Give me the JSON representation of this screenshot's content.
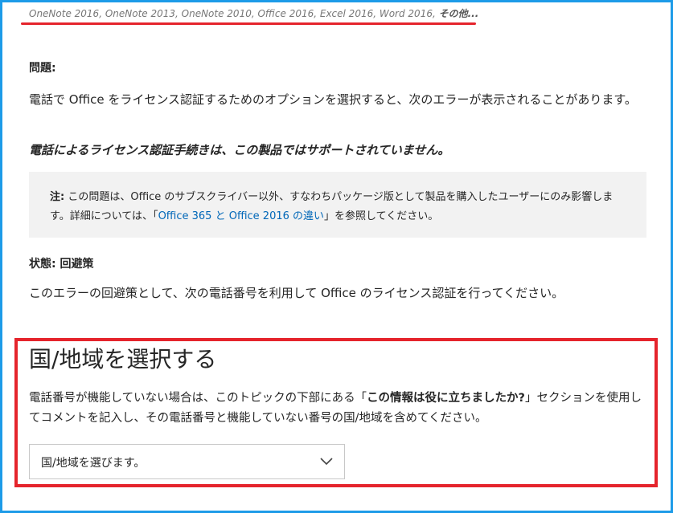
{
  "products": {
    "list": "OneNote 2016, OneNote 2013, OneNote 2010, Office 2016, Excel 2016, Word 2016, ",
    "more": "その他..."
  },
  "issue": {
    "label": "問題:",
    "desc": "電話で Office をライセンス認証するためのオプションを選択すると、次のエラーが表示されることがあります。",
    "error": "電話によるライセンス認証手続きは、この製品ではサポートされていません。"
  },
  "note": {
    "prefix": "注:",
    "text1": " この問題は、Office のサブスクライバー以外、すなわちパッケージ版として製品を購入したユーザーにのみ影響します。詳細については、「",
    "link": "Office 365 と Office 2016 の違い",
    "text2": "」を参照してください。"
  },
  "status": {
    "label": "状態: 回避策",
    "desc": "このエラーの回避策として、次の電話番号を利用して Office のライセンス認証を行ってください。"
  },
  "region": {
    "title": "国/地域を選択する",
    "desc1": "電話番号が機能していない場合は、このトピックの下部にある「",
    "desc_bold": "この情報は役に立ちましたか?",
    "desc2": "」セクションを使用してコメントを記入し、その電話番号と機能していない番号の国/地域を含めてください。",
    "select_value": "国/地域を選びます。"
  },
  "colors": {
    "frame": "#1d9be8",
    "highlight": "#e5242c",
    "link": "#0067b8"
  }
}
